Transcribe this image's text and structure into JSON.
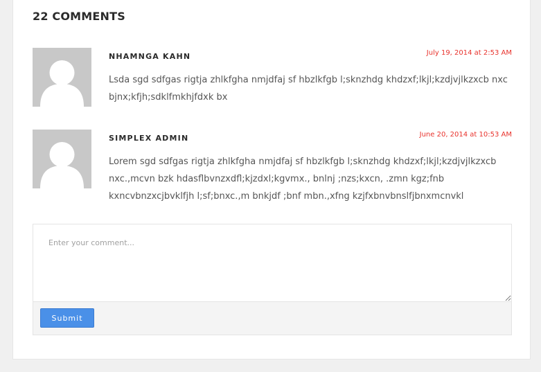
{
  "comments_section": {
    "heading": "22 COMMENTS",
    "comments": [
      {
        "author": "NHAMNGA KAHN",
        "date": "July 19, 2014 at 2:53 AM",
        "text": "Lsda sgd sdfgas rigtja zhlkfgha nmjdfaj sf hbzlkfgb l;sknzhdg khdzxf;lkjl;kzdjvjlkzxcb nxc bjnx;kfjh;sdklfmkhjfdxk bx",
        "avatar_icon": "default-user-avatar-icon"
      },
      {
        "author": "SIMPLEX ADMIN",
        "date": "June 20, 2014 at 10:53 AM",
        "text": "Lorem sgd sdfgas rigtja zhlkfgha nmjdfaj sf hbzlkfgb l;sknzhdg khdzxf;lkjl;kzdjvjlkzxcb nxc.,mcvn bzk hdasflbvnzxdfl;kjzdxl;kgvmx., bnlnj ;nzs;kxcn, .zmn kgz;fnb kxncvbnzxcjbvklfjh l;sf;bnxc.,m bnkjdf ;bnf mbn.,xfng kzjfxbnvbnslfjbnxmcnvkl",
        "avatar_icon": "default-user-avatar-icon"
      }
    ],
    "form": {
      "placeholder": "Enter your comment...",
      "submit_label": "Submit"
    }
  },
  "colors": {
    "date": "#e8322c",
    "submit_button": "#4a90e8",
    "avatar_bg": "#c8c8c8"
  }
}
